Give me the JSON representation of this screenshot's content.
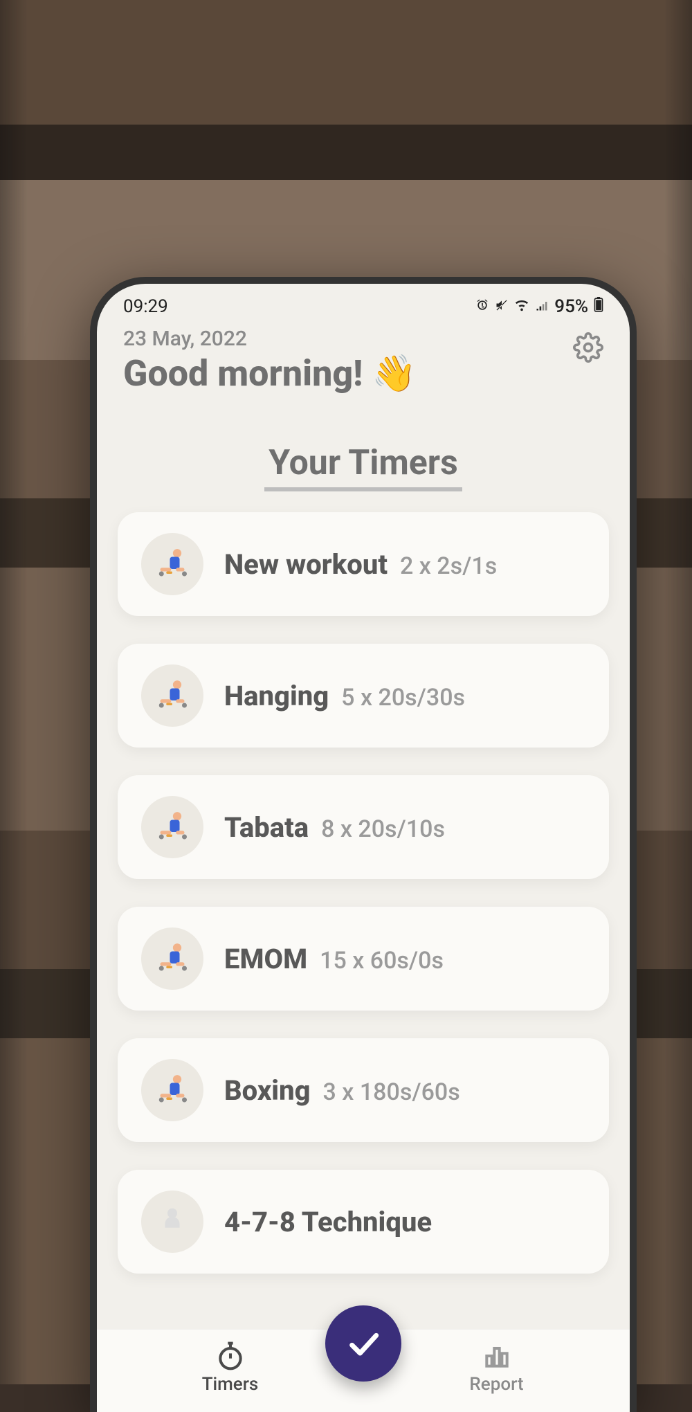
{
  "status": {
    "time": "09:29",
    "battery": "95%"
  },
  "header": {
    "date": "23 May, 2022",
    "greeting": "Good morning! 👋"
  },
  "section_title": "Your Timers",
  "timers": [
    {
      "name": "New workout",
      "detail": "2 x 2s/1s"
    },
    {
      "name": "Hanging",
      "detail": "5 x 20s/30s"
    },
    {
      "name": "Tabata",
      "detail": "8 x 20s/10s"
    },
    {
      "name": "EMOM",
      "detail": "15 x 60s/0s"
    },
    {
      "name": "Boxing",
      "detail": "3 x 180s/60s"
    },
    {
      "name": "4-7-8 Technique",
      "detail": ""
    }
  ],
  "nav": {
    "timers": "Timers",
    "report": "Report"
  }
}
